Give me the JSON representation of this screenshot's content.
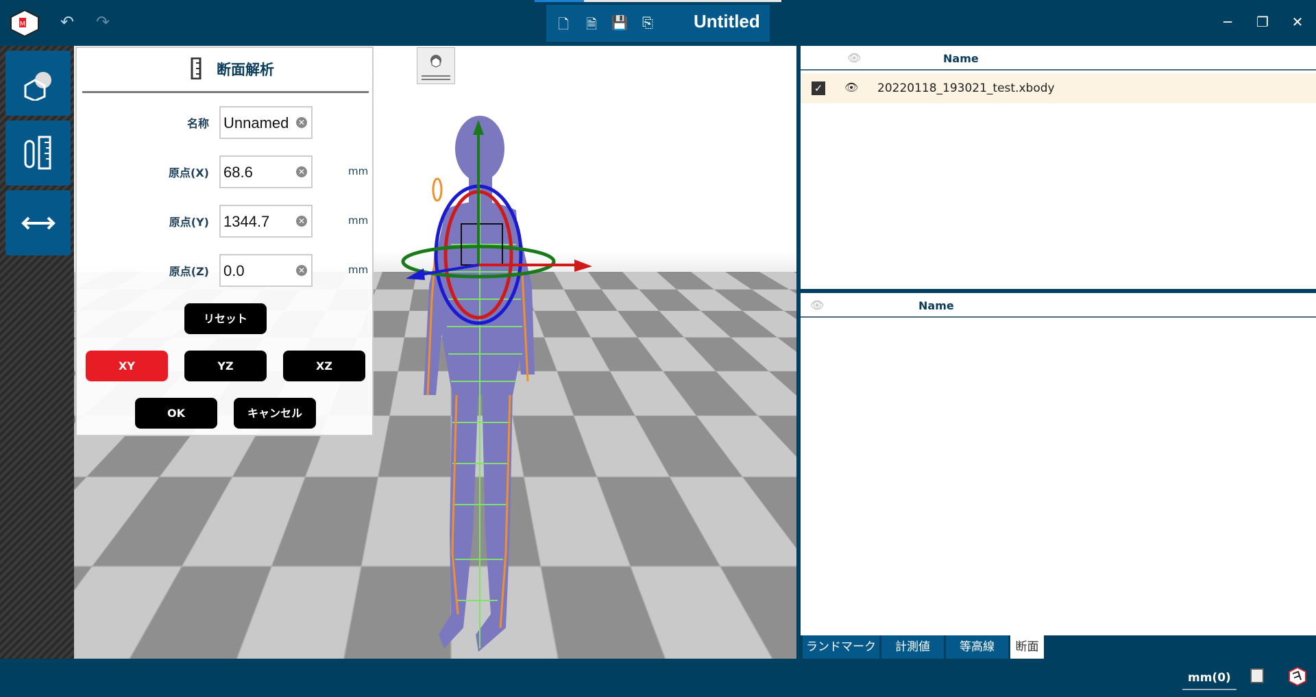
{
  "header": {
    "title": "Untitled",
    "icons": [
      "new-file-icon",
      "open-file-icon",
      "save-icon",
      "save-as-icon"
    ],
    "undo": "undo-icon",
    "redo": "redo-icon"
  },
  "window_controls": {
    "minimize": "─",
    "restore": "❐",
    "close": "✕"
  },
  "left_toolbar": [
    "body-model-icon",
    "measure-icon",
    "dimension-arrow-icon"
  ],
  "panel": {
    "title": "断面解析",
    "fields": [
      {
        "label": "名称",
        "value": "Unnamed",
        "unit": ""
      },
      {
        "label": "原点(X)",
        "value": "68.6",
        "unit": "mm"
      },
      {
        "label": "原点(Y)",
        "value": "1344.7",
        "unit": "mm"
      },
      {
        "label": "原点(Z)",
        "value": "0.0",
        "unit": "mm"
      }
    ],
    "reset": "リセット",
    "planes": [
      "XY",
      "YZ",
      "XZ"
    ],
    "selected_plane": "XY",
    "ok": "OK",
    "cancel": "キャンセル"
  },
  "file_table": {
    "header": "Name",
    "rows": [
      {
        "checked": true,
        "name": "20220118_193021_test.xbody"
      }
    ]
  },
  "section_table": {
    "header": "Name",
    "rows": []
  },
  "tabs": [
    "ランドマーク",
    "計測値",
    "等高線",
    "断面"
  ],
  "active_tab": "断面",
  "status": {
    "unit": "mm(0)"
  },
  "colors": {
    "topbar": "#003f5f",
    "accent": "#04598a",
    "selected": "#e81c24",
    "body": "#7b78c0"
  }
}
